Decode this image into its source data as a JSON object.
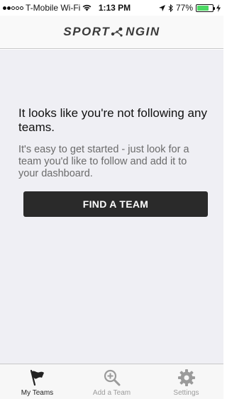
{
  "status_bar": {
    "carrier": "T-Mobile Wi-Fi",
    "time": "1:13 PM",
    "battery": "77%",
    "battery_level": 0.77,
    "signal_bars": 2,
    "signal_total": 5
  },
  "nav": {
    "logo_part1": "SPORT",
    "logo_part2": "NGIN"
  },
  "empty_state": {
    "title": "It looks like you're not following any teams.",
    "body": "It's easy to get started - just look for a team you'd like to follow and add it to your dashboard.",
    "button_label": "FIND A TEAM"
  },
  "tabs": [
    {
      "label": "My Teams",
      "icon": "flag-icon",
      "active": true
    },
    {
      "label": "Add a Team",
      "icon": "zoom-in-icon",
      "active": false
    },
    {
      "label": "Settings",
      "icon": "gear-icon",
      "active": false
    }
  ],
  "colors": {
    "content_bg": "#efeff4",
    "button_bg": "#2a2a2a",
    "battery_fill": "#4cd964",
    "active_tab": "#222222",
    "inactive_tab": "#9b9b9b"
  }
}
